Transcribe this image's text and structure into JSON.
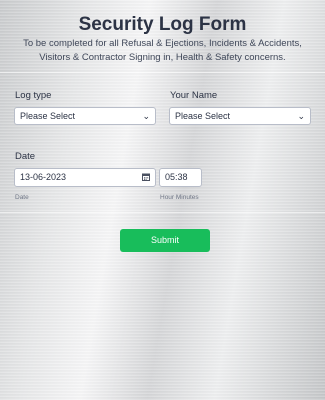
{
  "form": {
    "title": "Security Log Form",
    "subtitle": "To be completed for all Refusal & Ejections, Incidents & Accidents, Visitors & Contractor Signing in, Health & Safety concerns."
  },
  "fields": {
    "log_type": {
      "label": "Log type",
      "value": "Please Select"
    },
    "your_name": {
      "label": "Your Name",
      "value": "Please Select"
    },
    "date": {
      "label": "Date",
      "date_value": "13-06-2023",
      "date_sublabel": "Date",
      "time_value": "05:38",
      "time_sublabel": "Hour Minutes"
    }
  },
  "submit": {
    "label": "Submit"
  },
  "colors": {
    "submit_bg": "#18bd5b",
    "title": "#2c3345"
  }
}
